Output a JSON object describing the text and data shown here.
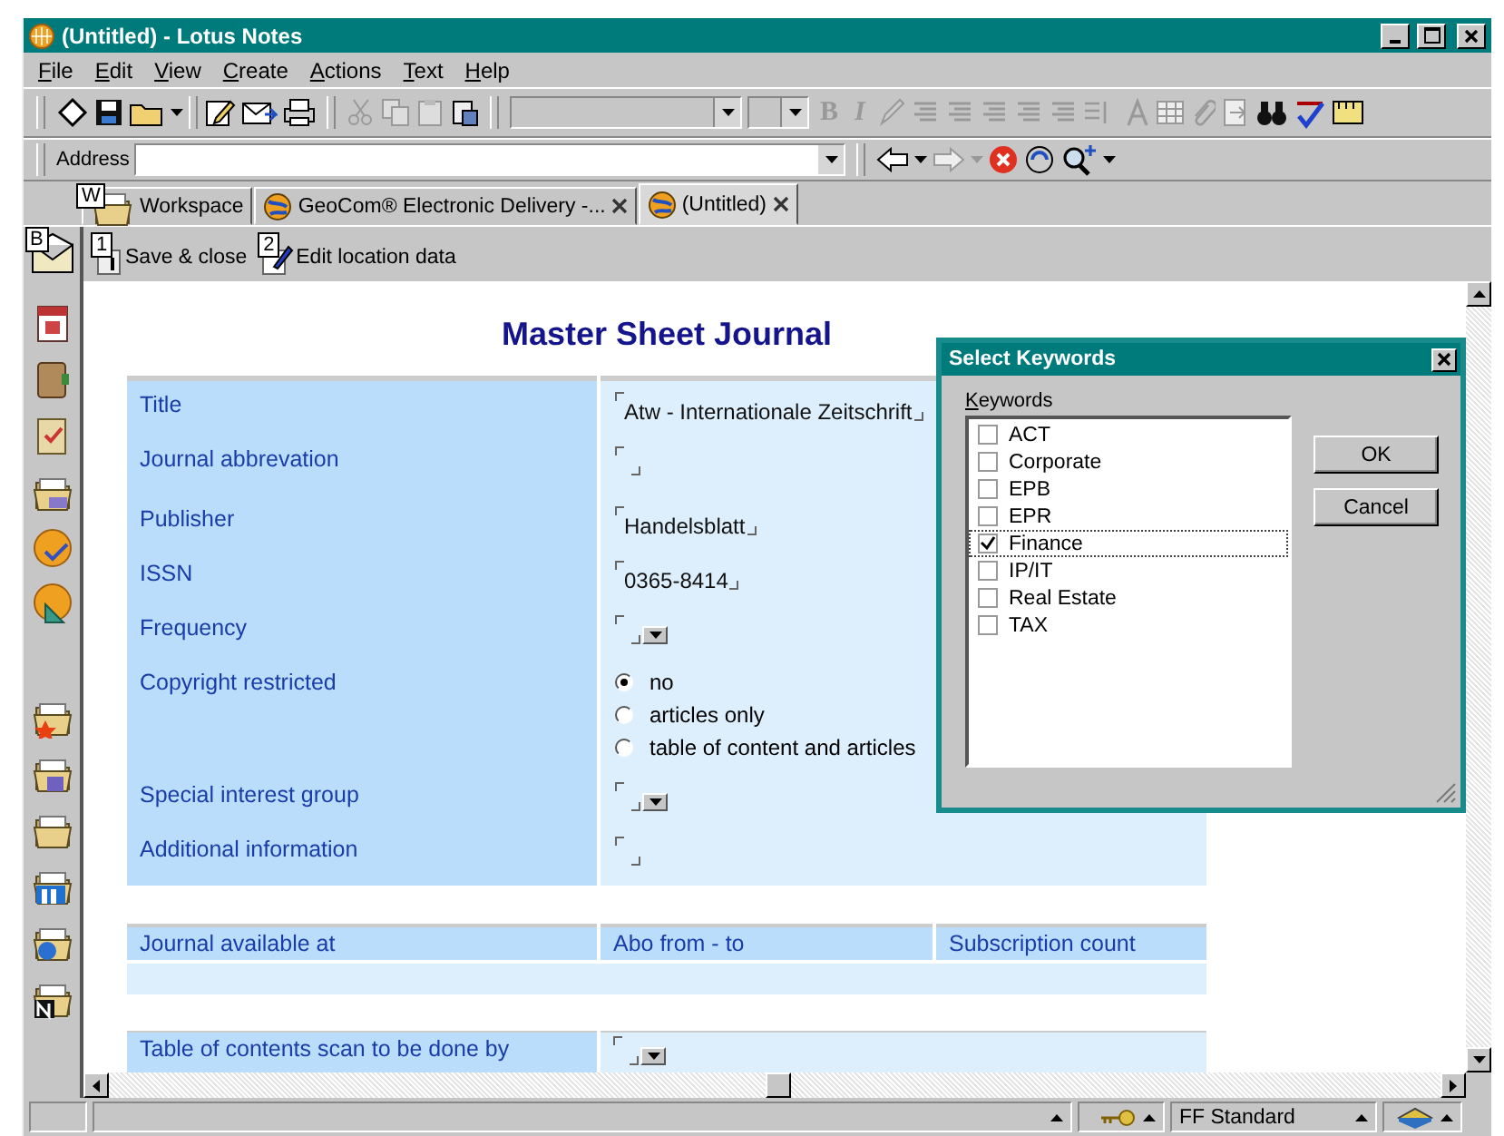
{
  "window": {
    "title": "(Untitled) - Lotus Notes"
  },
  "menu": [
    "File",
    "Edit",
    "View",
    "Create",
    "Actions",
    "Text",
    "Help"
  ],
  "toolbar": {
    "bold": "B",
    "italic": "I"
  },
  "address": {
    "label": "Address"
  },
  "tabs": [
    {
      "label": "Workspace",
      "hotkey": "W",
      "closable": false,
      "selected": false
    },
    {
      "label": "GeoCom® Electronic Delivery -...",
      "closable": true,
      "selected": false
    },
    {
      "label": "(Untitled)",
      "closable": true,
      "selected": true
    }
  ],
  "bookmarks": {
    "hotkey": "B"
  },
  "actions": [
    {
      "hotkey": "1",
      "label": "Save & close"
    },
    {
      "hotkey": "2",
      "label": "Edit location data"
    }
  ],
  "form": {
    "title": "Master Sheet Journal",
    "rows": [
      {
        "label": "Title",
        "kind": "text",
        "value": "Atw - Internationale Zeitschrift"
      },
      {
        "label": "Journal abbrevation",
        "kind": "empty"
      },
      {
        "label": "Publisher",
        "kind": "text",
        "value": "Handelsblatt"
      },
      {
        "label": "ISSN",
        "kind": "text",
        "value": "0365-8414"
      },
      {
        "label": "Frequency",
        "kind": "dropdown"
      },
      {
        "label": "Copyright restricted",
        "kind": "radio",
        "options": [
          {
            "label": "no",
            "selected": true
          },
          {
            "label": "articles only",
            "selected": false
          },
          {
            "label": "table of content and articles",
            "selected": false
          }
        ]
      },
      {
        "label": "Special interest group",
        "kind": "dropdown"
      },
      {
        "label": "Additional information",
        "kind": "empty"
      }
    ]
  },
  "availability_table": {
    "columns": [
      "Journal available at",
      "Abo from - to",
      "Subscription count"
    ]
  },
  "scan_row": {
    "label": "Table of contents scan to be done by",
    "kind": "dropdown"
  },
  "dialog": {
    "title": "Select Keywords",
    "list_label": "Keywords",
    "items": [
      {
        "label": "ACT",
        "checked": false,
        "selected": false
      },
      {
        "label": "Corporate",
        "checked": false,
        "selected": false
      },
      {
        "label": "EPB",
        "checked": false,
        "selected": false
      },
      {
        "label": "EPR",
        "checked": false,
        "selected": false
      },
      {
        "label": "Finance",
        "checked": true,
        "selected": true
      },
      {
        "label": "IP/IT",
        "checked": false,
        "selected": false
      },
      {
        "label": "Real Estate",
        "checked": false,
        "selected": false
      },
      {
        "label": "TAX",
        "checked": false,
        "selected": false
      }
    ],
    "buttons": [
      "OK",
      "Cancel"
    ]
  },
  "status_bar": {
    "location": "FF Standard"
  }
}
